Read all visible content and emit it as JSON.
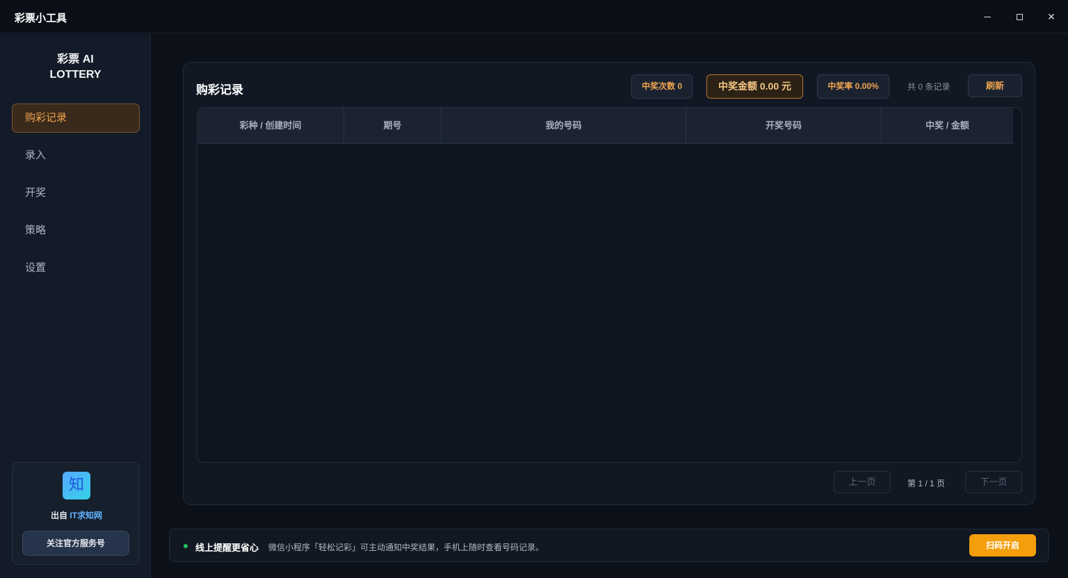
{
  "window": {
    "title": "彩票小工具",
    "controls": {
      "minimize": "minimize-icon",
      "maximize": "maximize-icon",
      "close": "✕"
    }
  },
  "sidebar": {
    "brand_line1": "彩票 AI",
    "brand_line2": "LOTTERY",
    "items": [
      {
        "label": "购彩记录",
        "active": true
      },
      {
        "label": "录入",
        "active": false
      },
      {
        "label": "开奖",
        "active": false
      },
      {
        "label": "策略",
        "active": false
      },
      {
        "label": "设置",
        "active": false
      }
    ],
    "promo": {
      "logo_char": "知",
      "from_prefix": "出自 ",
      "from_name": "IT求知网",
      "follow_label": "关注官方服务号"
    }
  },
  "records": {
    "title": "购彩记录",
    "stats": {
      "win_count": "中奖次数 0",
      "win_amount": "中奖金额 0.00 元",
      "win_rate": "中奖率 0.00%"
    },
    "total": "共 0 条记录",
    "refresh_label": "刷新",
    "columns": [
      "彩种 / 创建时间",
      "期号",
      "我的号码",
      "开奖号码",
      "中奖 / 金额"
    ],
    "rows": [],
    "pagination": {
      "prev_label": "上一页",
      "page_info": "第 1 / 1 页",
      "next_label": "下一页"
    }
  },
  "notice": {
    "title": "线上提醒更省心",
    "description": "微信小程序「轻松记彩」可主动通知中奖结果，手机上随时查看号码记录。",
    "button_label": "扫码开启"
  },
  "colors": {
    "accent": "#f59e0b",
    "accent_text": "#f2a64f",
    "active_nav_bg": "#3a2a1c",
    "status_dot": "#22c55e",
    "link": "#62b4ff"
  }
}
